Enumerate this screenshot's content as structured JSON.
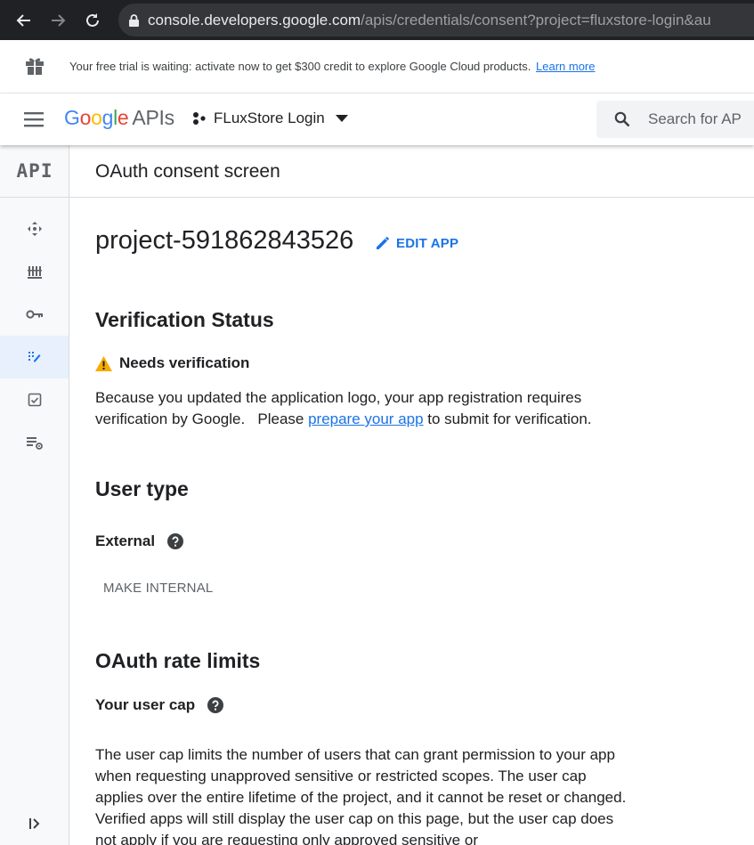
{
  "browser": {
    "url_host": "console.developers.google.com",
    "url_path": "/apis/credentials/consent?project=fluxstore-login&au"
  },
  "trial_banner": {
    "text": "Your free trial is waiting: activate now to get $300 credit to explore Google Cloud products.",
    "link_label": "Learn more"
  },
  "header": {
    "logo_google": [
      "G",
      "o",
      "o",
      "g",
      "l",
      "e"
    ],
    "logo_apis": "APIs",
    "project_name": "FLuxStore Login",
    "search_placeholder": "Search for AP"
  },
  "rail": {
    "api_label": "API",
    "items": [
      "dashboard-icon",
      "library-icon",
      "credentials-icon",
      "consent-screen-icon",
      "domain-verification-icon",
      "page-usage-icon"
    ],
    "active_index": 3
  },
  "page": {
    "title": "OAuth consent screen",
    "project_id": "project-591862843526",
    "edit_app_label": "EDIT APP"
  },
  "verification": {
    "heading": "Verification Status",
    "status": "Needs verification",
    "text_before_link": "Because you updated the application logo, your app registration requires verification by Google.   Please ",
    "link_label": "prepare your app",
    "text_after_link": " to submit for verification."
  },
  "user_type": {
    "heading": "User type",
    "value": "External",
    "button_label": "MAKE INTERNAL"
  },
  "rate_limits": {
    "heading": "OAuth rate limits",
    "subheading": "Your user cap",
    "paragraph": "The user cap limits the number of users that can grant permission to your app when requesting unapproved sensitive or restricted scopes. The user cap applies over the entire lifetime of the project, and it cannot be reset or changed. Verified apps will still display the user cap on this page, but the user cap does not apply if you are requesting only approved sensitive or"
  },
  "colors": {
    "accent": "#1a73e8",
    "warning": "#f9ab00",
    "active_rail": "#e8f0fe",
    "google_blue": "#4285f4",
    "google_red": "#ea4335",
    "google_yellow": "#fbbc04",
    "google_green": "#34a853"
  }
}
